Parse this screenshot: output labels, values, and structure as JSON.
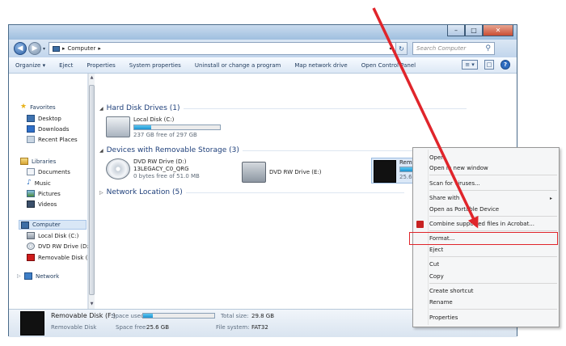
{
  "window": {
    "titlebar_buttons": [
      "–",
      "□",
      "✕"
    ]
  },
  "address": {
    "back_icon": "back-arrow-icon",
    "forward_icon": "forward-arrow-icon",
    "path_separator": "▸",
    "path": "Computer",
    "path_trailing": "▸",
    "dropdown": "▾",
    "refresh": "↻",
    "search_placeholder": "Search Computer",
    "search_icon": "⚲"
  },
  "toolbar": {
    "items": [
      "Organize ▾",
      "Eject",
      "Properties",
      "System properties",
      "Uninstall or change a program",
      "Map network drive",
      "Open Control Panel"
    ],
    "view_icon": "≡ ▾",
    "pane_icon": "□",
    "help_icon": "?"
  },
  "navpane": {
    "favorites": "Favorites",
    "desktop": "Desktop",
    "downloads": "Downloads",
    "recent": "Recent Places",
    "libraries": "Libraries",
    "documents": "Documents",
    "music": "Music",
    "pictures": "Pictures",
    "videos": "Videos",
    "computer": "Computer",
    "local_disk": "Local Disk (C:)",
    "dvd_drive": "DVD RW Drive (D:",
    "removable": "Removable Disk (I",
    "network": "Network"
  },
  "content": {
    "hdd_group": "Hard Disk Drives (1)",
    "local_disk_name": "Local Disk (C:)",
    "local_disk_used_fraction": 0.2,
    "local_disk_free": "237 GB free of 297 GB",
    "removable_group": "Devices with Removable Storage (3)",
    "dvd_d_name": "DVD RW Drive (D:)",
    "dvd_d_label": "13LEGACY_C0_QRG",
    "dvd_d_free": "0 bytes free of 51.0 MB",
    "dvd_e_name": "DVD RW Drive (E:)",
    "rem_name": "Removable Disk (F:)",
    "rem_used_fraction": 0.14,
    "rem_free": "25.6 GB",
    "network_group": "Network Location (5)"
  },
  "context_menu": {
    "open": "Open",
    "open_new_window": "Open in new window",
    "scan": "Scan for viruses...",
    "share_with": "Share with",
    "open_portable": "Open as Portable Device",
    "combine_acrobat": "Combine supported files in Acrobat...",
    "format": "Format...",
    "eject": "Eject",
    "cut": "Cut",
    "copy": "Copy",
    "create_shortcut": "Create shortcut",
    "rename": "Rename",
    "properties": "Properties",
    "submenu_arrow": "▸"
  },
  "details": {
    "name": "Removable Disk (F:)",
    "type": "Removable Disk",
    "space_used_label": "Space used:",
    "space_used_fraction": 0.14,
    "space_free_label": "Space free:",
    "space_free_value": "25.6 GB",
    "total_size_label": "Total size:",
    "total_size_value": "29.8 GB",
    "file_system_label": "File system:",
    "file_system_value": "FAT32"
  },
  "colors": {
    "annotation_red": "#e0252b",
    "selection_blue": "#dbe8f7",
    "bar_fill": "#1e92cf"
  }
}
